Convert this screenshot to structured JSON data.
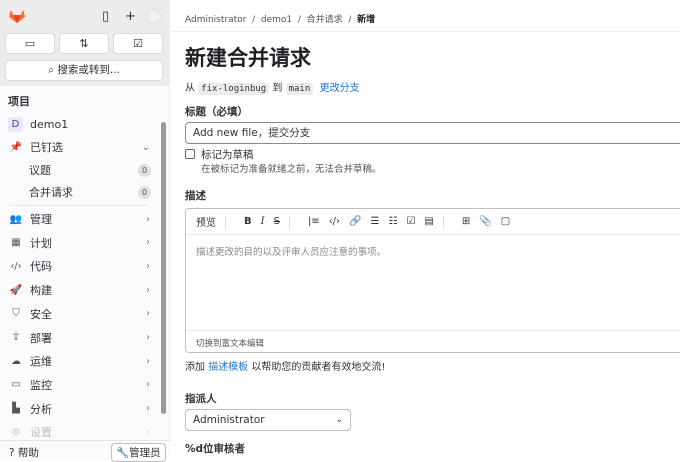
{
  "topbar": {
    "search_label": "搜索或转到..."
  },
  "sidebar": {
    "section": "项目",
    "project": {
      "initial": "D",
      "name": "demo1"
    },
    "pinned": {
      "label": "已钉选",
      "items": [
        {
          "label": "议题",
          "count": "0"
        },
        {
          "label": "合并请求",
          "count": "0"
        }
      ]
    },
    "items": [
      {
        "label": "管理",
        "icon": "users-icon"
      },
      {
        "label": "计划",
        "icon": "calendar-icon"
      },
      {
        "label": "代码",
        "icon": "code-icon"
      },
      {
        "label": "构建",
        "icon": "rocket-icon"
      },
      {
        "label": "安全",
        "icon": "shield-icon"
      },
      {
        "label": "部署",
        "icon": "deploy-icon"
      },
      {
        "label": "运维",
        "icon": "cloud-icon"
      },
      {
        "label": "监控",
        "icon": "monitor-icon"
      },
      {
        "label": "分析",
        "icon": "chart-icon"
      },
      {
        "label": "设置",
        "icon": "settings-icon"
      }
    ],
    "help": "帮助",
    "admin": "管理员"
  },
  "breadcrumb": [
    "Administrator",
    "demo1",
    "合并请求",
    "新增"
  ],
  "page": {
    "title": "新建合并请求",
    "from": "从",
    "source": "fix-loginbug",
    "to": "到",
    "target": "main",
    "change_branches": "更改分支",
    "title_label": "标题（必填）",
    "title_value": "Add new file，提交分支",
    "draft_label": "标记为草稿",
    "draft_help": "在被标记为准备就绪之前，无法合并草稿。",
    "desc_label": "描述",
    "preview": "预览",
    "desc_placeholder": "描述更改的目的以及评审人员应注意的事项。",
    "rich_text": "切换到富文本编辑",
    "template_prefix": "添加",
    "template_link": "描述模板",
    "template_suffix": "以帮助您的贡献者有效地交流!",
    "assignee_label": "指派人",
    "assignee_value": "Administrator",
    "reviewers_label": "%d位审核者"
  },
  "colors": {
    "accent": "#1f75cb",
    "logo": "#fc6d26"
  }
}
